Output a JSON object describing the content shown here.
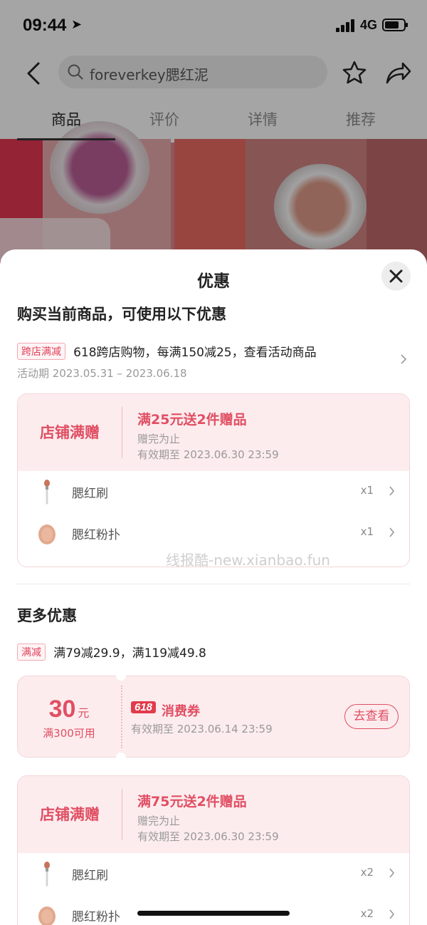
{
  "status_bar": {
    "time": "09:44",
    "network": "4G"
  },
  "nav": {
    "search_text": "foreverkey腮红泥"
  },
  "tabs": [
    {
      "label": "商品",
      "active": true
    },
    {
      "label": "评价",
      "active": false
    },
    {
      "label": "详情",
      "active": false
    },
    {
      "label": "推荐",
      "active": false
    }
  ],
  "sheet": {
    "title": "优惠",
    "section1_title": "购买当前商品，可使用以下优惠",
    "cross_store": {
      "tag": "跨店满减",
      "text": "618跨店购物，每满150减25，查看活动商品",
      "period": "活动期 2023.05.31 – 2023.06.18"
    },
    "gift_card_1": {
      "label": "店铺满赠",
      "headline": "满25元送2件赠品",
      "status": "赠完为止",
      "validity": "有效期至 2023.06.30 23:59",
      "items": [
        {
          "name": "腮红刷",
          "qty": "x1",
          "icon": "brush-icon"
        },
        {
          "name": "腮红粉扑",
          "qty": "x1",
          "icon": "puff-icon"
        }
      ]
    },
    "watermark": "线报酷-new.xianbao.fun",
    "section2_title": "更多优惠",
    "discount": {
      "tag": "满减",
      "text": "满79减29.9，满119减49.8"
    },
    "coupon": {
      "amount": "30",
      "unit": "元",
      "condition": "满300可用",
      "badge": "618",
      "type": "消费券",
      "validity": "有效期至 2023.06.14 23:59",
      "button": "去查看"
    },
    "gift_card_2": {
      "label": "店铺满赠",
      "headline": "满75元送2件赠品",
      "status": "赠完为止",
      "validity": "有效期至 2023.06.30 23:59",
      "items": [
        {
          "name": "腮红刷",
          "qty": "x2",
          "icon": "brush-icon"
        },
        {
          "name": "腮红粉扑",
          "qty": "x2",
          "icon": "puff-icon"
        }
      ]
    }
  },
  "colors": {
    "accent": "#e04f63",
    "card_bg": "#fdecee",
    "tag_border": "#f2a8b0"
  }
}
